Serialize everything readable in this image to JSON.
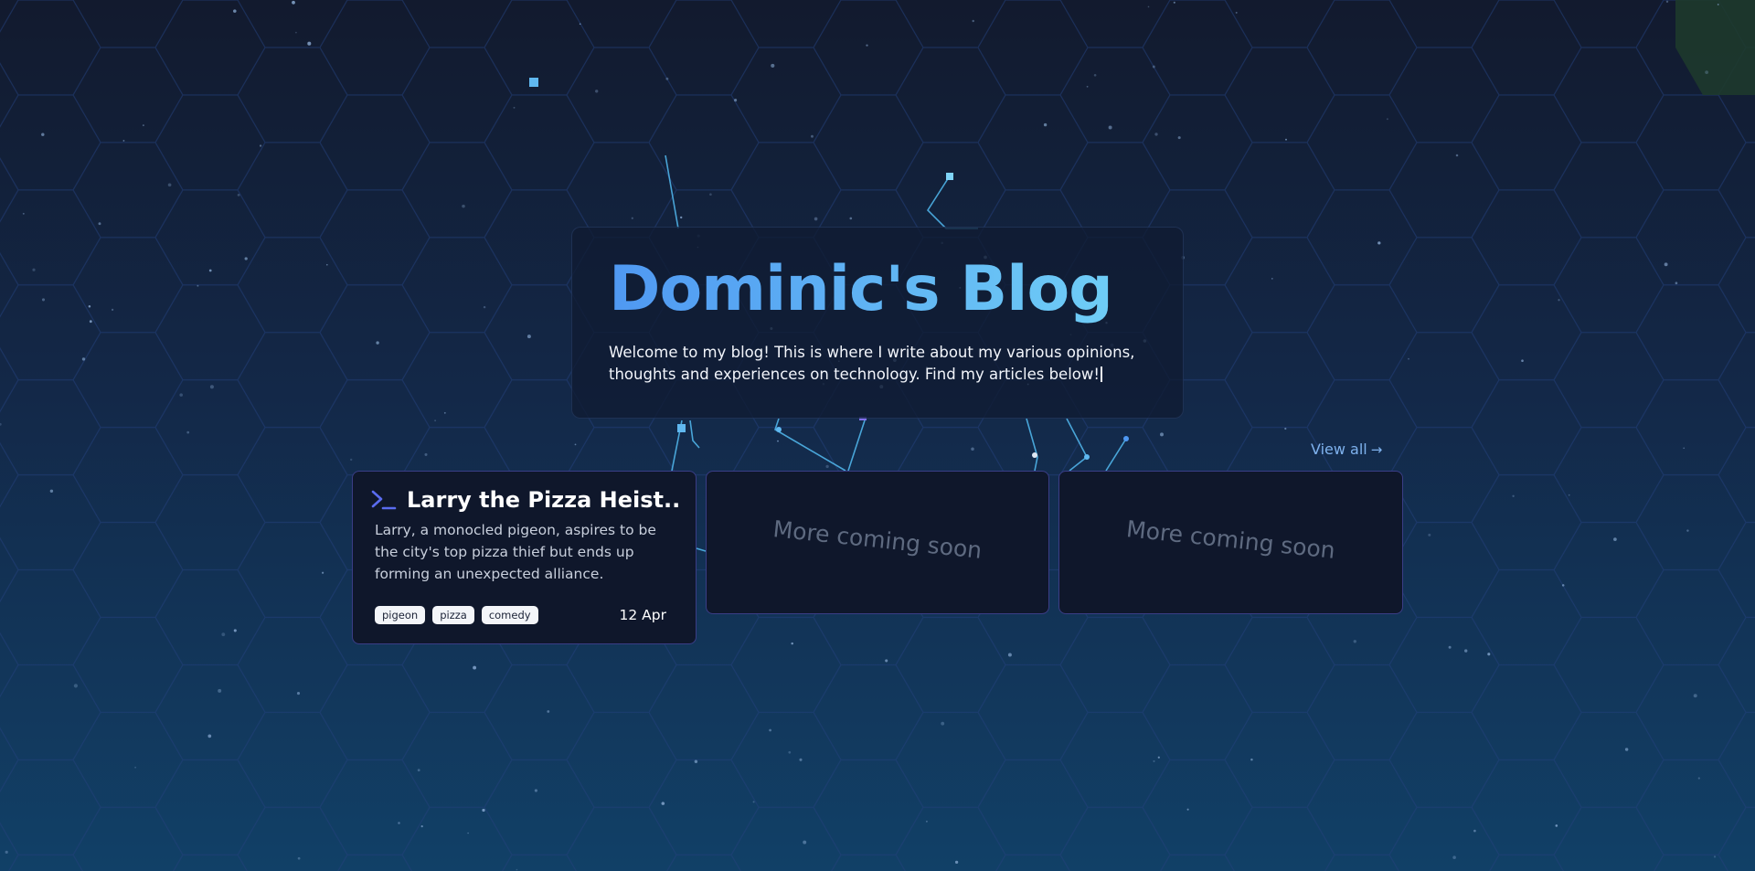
{
  "header": {
    "title": "Dominic's Blog",
    "description": "Welcome to my blog! This is where I write about my various opinions, thoughts and experiences on technology. Find my articles below!"
  },
  "articles_section": {
    "view_all_label": "View all",
    "view_all_icon": "arrow-right-icon"
  },
  "articles": [
    {
      "icon": "terminal-prompt-icon",
      "title": "Larry the Pizza Heist...",
      "summary": "Larry, a monocled pigeon, aspires to be the city's top pizza thief but ends up forming an unexpected alliance.",
      "tags": [
        "pigeon",
        "pizza",
        "comedy"
      ],
      "date": "12 Apr"
    }
  ],
  "placeholders": [
    {
      "text": "More coming soon"
    },
    {
      "text": "More coming soon"
    }
  ],
  "colors": {
    "background_top": "#121a2e",
    "background_bottom": "#114067",
    "title_gradient_start": "#4f98f2",
    "title_gradient_end": "#6fcdf6",
    "card_border": "#3a3d86",
    "link": "#7fb2ee",
    "accent_icon": "#5a6cf0"
  }
}
